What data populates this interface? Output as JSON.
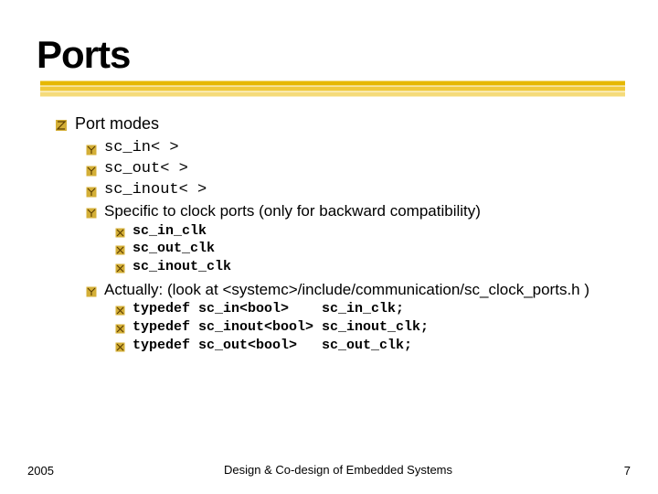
{
  "title": "Ports",
  "l1": "Port modes",
  "modes": {
    "a": "sc_in< >",
    "b": "sc_out< >",
    "c": "sc_inout< >"
  },
  "specific": "Specific to clock ports (only for backward compatibility)",
  "clk": {
    "a": "sc_in_clk",
    "b": "sc_out_clk",
    "c": "sc_inout_clk"
  },
  "actually": "Actually: (look at <systemc>/include/communication/sc_clock_ports.h )",
  "typedef": {
    "a": "typedef sc_in<bool>    sc_in_clk;",
    "b": "typedef sc_inout<bool> sc_inout_clk;",
    "c": "typedef sc_out<bool>   sc_out_clk;"
  },
  "footer": {
    "year": "2005",
    "center": "Design & Co-design of Embedded Systems",
    "page": "7"
  }
}
